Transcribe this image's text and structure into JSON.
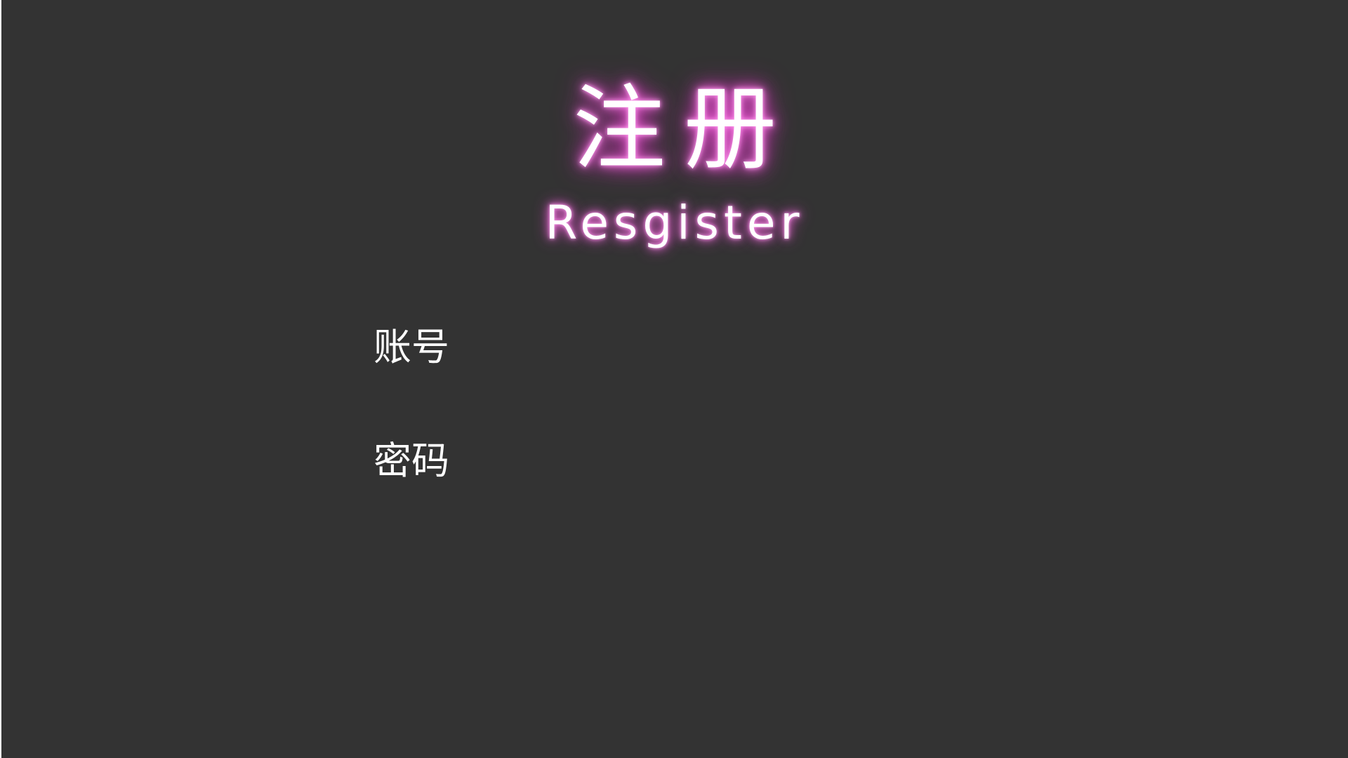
{
  "header": {
    "title_cn": "注册",
    "title_en": "Resgister"
  },
  "form": {
    "account": {
      "label": "账号",
      "value": "",
      "placeholder": ""
    },
    "password": {
      "label": "密码",
      "value": "",
      "placeholder": ""
    }
  },
  "colors": {
    "background": "#333333",
    "text": "#ffffff",
    "glow": "#e040c8"
  }
}
